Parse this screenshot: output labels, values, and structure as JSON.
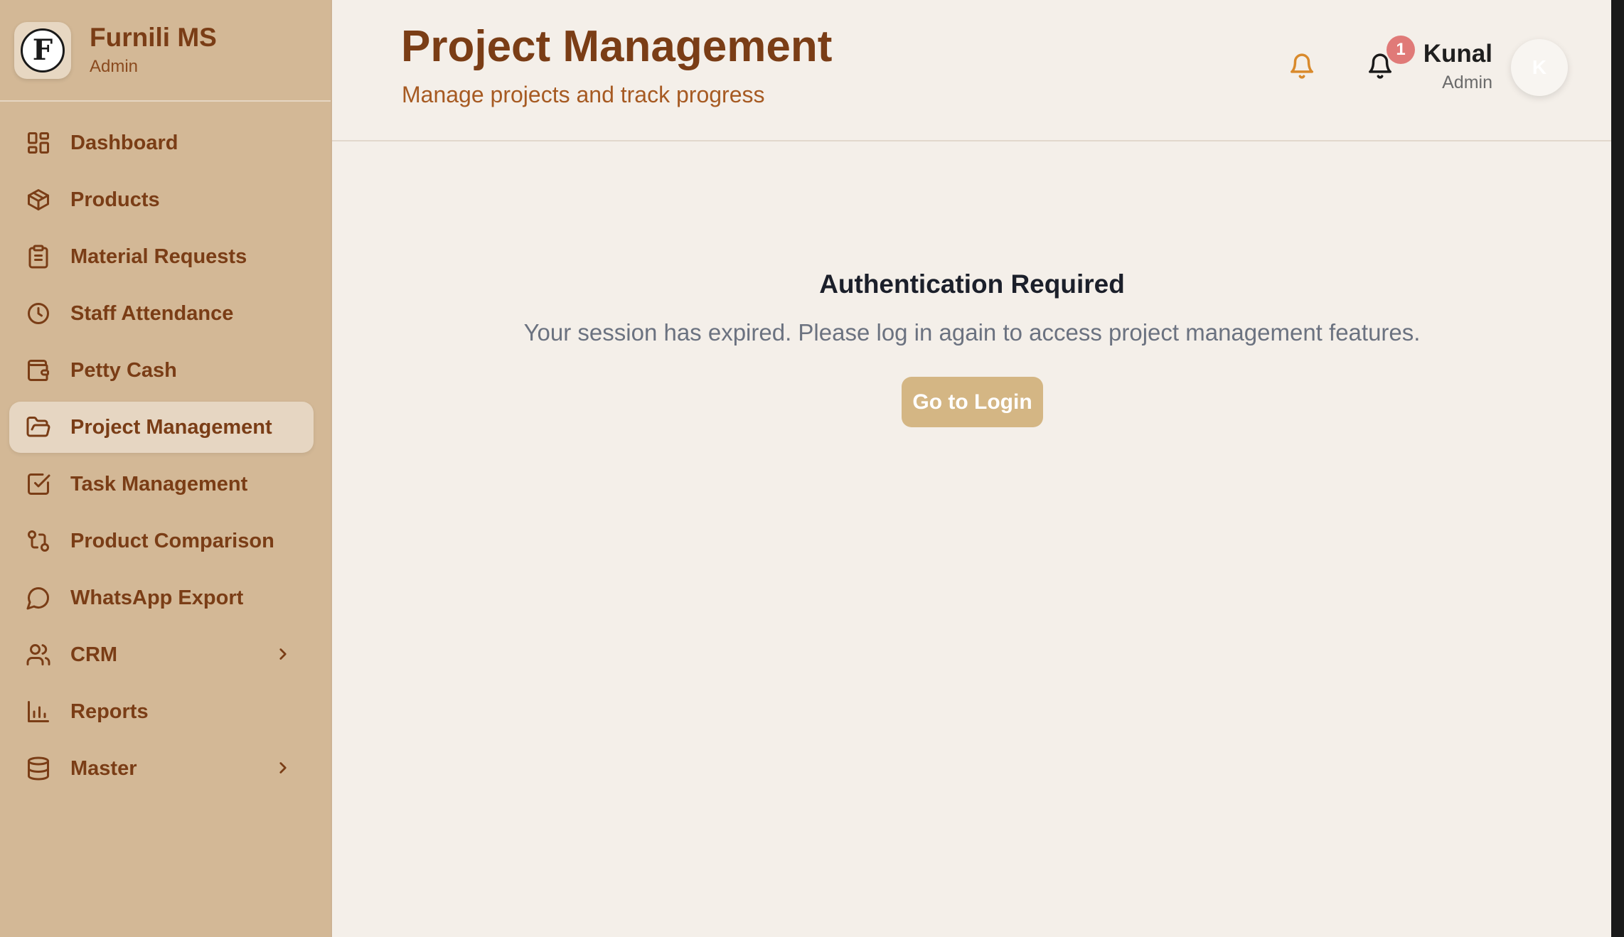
{
  "brand": {
    "name": "Furnili MS",
    "role": "Admin",
    "logo_letter": "F"
  },
  "sidebar": {
    "items": [
      {
        "label": "Dashboard",
        "icon": "dashboard-icon"
      },
      {
        "label": "Products",
        "icon": "package-icon"
      },
      {
        "label": "Material Requests",
        "icon": "clipboard-icon"
      },
      {
        "label": "Staff Attendance",
        "icon": "clock-icon"
      },
      {
        "label": "Petty Cash",
        "icon": "wallet-icon"
      },
      {
        "label": "Project Management",
        "icon": "folder-open-icon",
        "active": true
      },
      {
        "label": "Task Management",
        "icon": "check-square-icon"
      },
      {
        "label": "Product Comparison",
        "icon": "git-compare-icon"
      },
      {
        "label": "WhatsApp Export",
        "icon": "message-circle-icon"
      },
      {
        "label": "CRM",
        "icon": "users-icon",
        "expandable": true
      },
      {
        "label": "Reports",
        "icon": "bar-chart-icon"
      },
      {
        "label": "Master",
        "icon": "database-icon",
        "expandable": true
      }
    ]
  },
  "header": {
    "title": "Project Management",
    "subtitle": "Manage projects and track progress",
    "notification_count": "1",
    "user": {
      "name": "Kunal",
      "role": "Admin",
      "initial": "K"
    }
  },
  "main": {
    "auth_title": "Authentication Required",
    "auth_message": "Your session has expired. Please log in again to access project management features.",
    "login_button": "Go to Login"
  },
  "colors": {
    "sidebar_bg": "#d3b896",
    "accent_brown": "#7a3d16",
    "subtitle_orange": "#a65a22",
    "button_bg": "#d4b684",
    "badge_red": "#e07a78",
    "page_bg": "#f4efe9"
  }
}
